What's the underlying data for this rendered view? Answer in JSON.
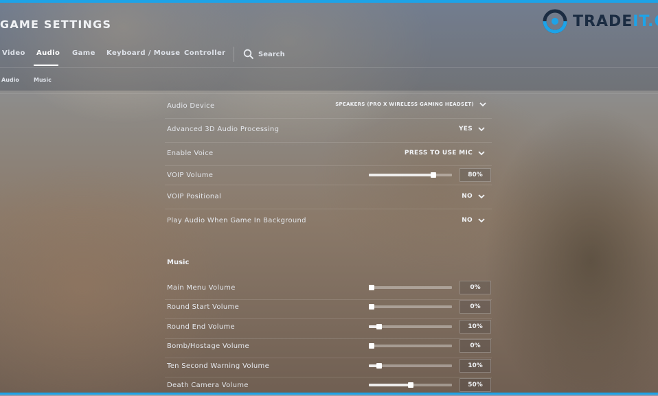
{
  "window": {
    "title": "GAME SETTINGS"
  },
  "logo": {
    "main": "TRADE",
    "accent": "IT.G"
  },
  "main_tabs": [
    {
      "label": "Video",
      "active": false
    },
    {
      "label": "Audio",
      "active": true
    },
    {
      "label": "Game",
      "active": false
    },
    {
      "label": "Keyboard / Mouse",
      "active": false
    },
    {
      "label": "Controller",
      "active": false
    }
  ],
  "search": {
    "label": "Search",
    "icon": "search-icon"
  },
  "sub_tabs": [
    {
      "label": "Audio"
    },
    {
      "label": "Music"
    }
  ],
  "audio_settings": {
    "audio_device": {
      "label": "Audio Device",
      "value": "SPEAKERS (PRO X WIRELESS GAMING HEADSET)"
    },
    "advanced_3d": {
      "label": "Advanced 3D Audio Processing",
      "value": "YES"
    },
    "enable_voice": {
      "label": "Enable Voice",
      "value": "PRESS TO USE MIC"
    },
    "voip_volume": {
      "label": "VOIP Volume",
      "value": "80%",
      "level": 0.8
    },
    "voip_positional": {
      "label": "VOIP Positional",
      "value": "NO"
    },
    "play_in_background": {
      "label": "Play Audio When Game In Background",
      "value": "NO"
    }
  },
  "music": {
    "section_title": "Music",
    "items": [
      {
        "label": "Main Menu Volume",
        "value": "0%",
        "level": 0.0
      },
      {
        "label": "Round Start Volume",
        "value": "0%",
        "level": 0.0
      },
      {
        "label": "Round End Volume",
        "value": "10%",
        "level": 0.1
      },
      {
        "label": "Bomb/Hostage Volume",
        "value": "0%",
        "level": 0.0
      },
      {
        "label": "Ten Second Warning Volume",
        "value": "10%",
        "level": 0.1
      },
      {
        "label": "Death Camera Volume",
        "value": "50%",
        "level": 0.5
      }
    ]
  },
  "colors": {
    "accent": "#1da3e8",
    "logo_dark": "#1b2c42"
  }
}
